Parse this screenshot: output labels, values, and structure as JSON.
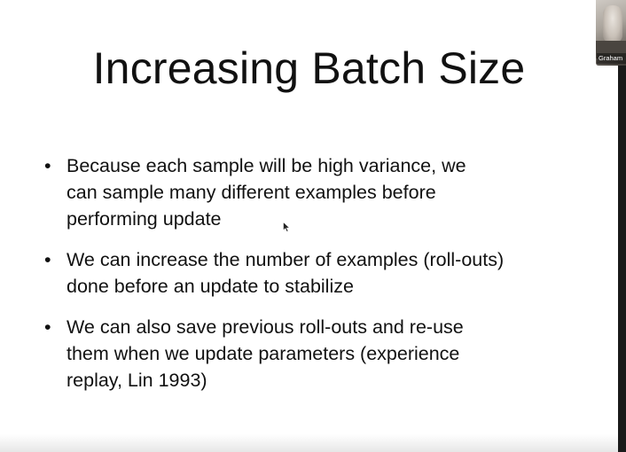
{
  "slide": {
    "title": "Increasing Batch Size",
    "bullet_symbol": "•",
    "bullets": [
      {
        "lines": [
          "Because each sample will be high variance, we",
          "can sample many different examples before",
          "performing update"
        ]
      },
      {
        "lines": [
          "We can increase the number of examples (roll-outs)",
          "done before an update to stabilize"
        ]
      },
      {
        "lines": [
          "We can also save previous roll-outs and re-use",
          "them when we update parameters (experience",
          "replay, Lin 1993)"
        ]
      }
    ]
  },
  "video": {
    "participant_name": "Graham"
  },
  "colors": {
    "text": "#111111",
    "background": "#ffffff",
    "side_bar": "#1a1a1a"
  }
}
